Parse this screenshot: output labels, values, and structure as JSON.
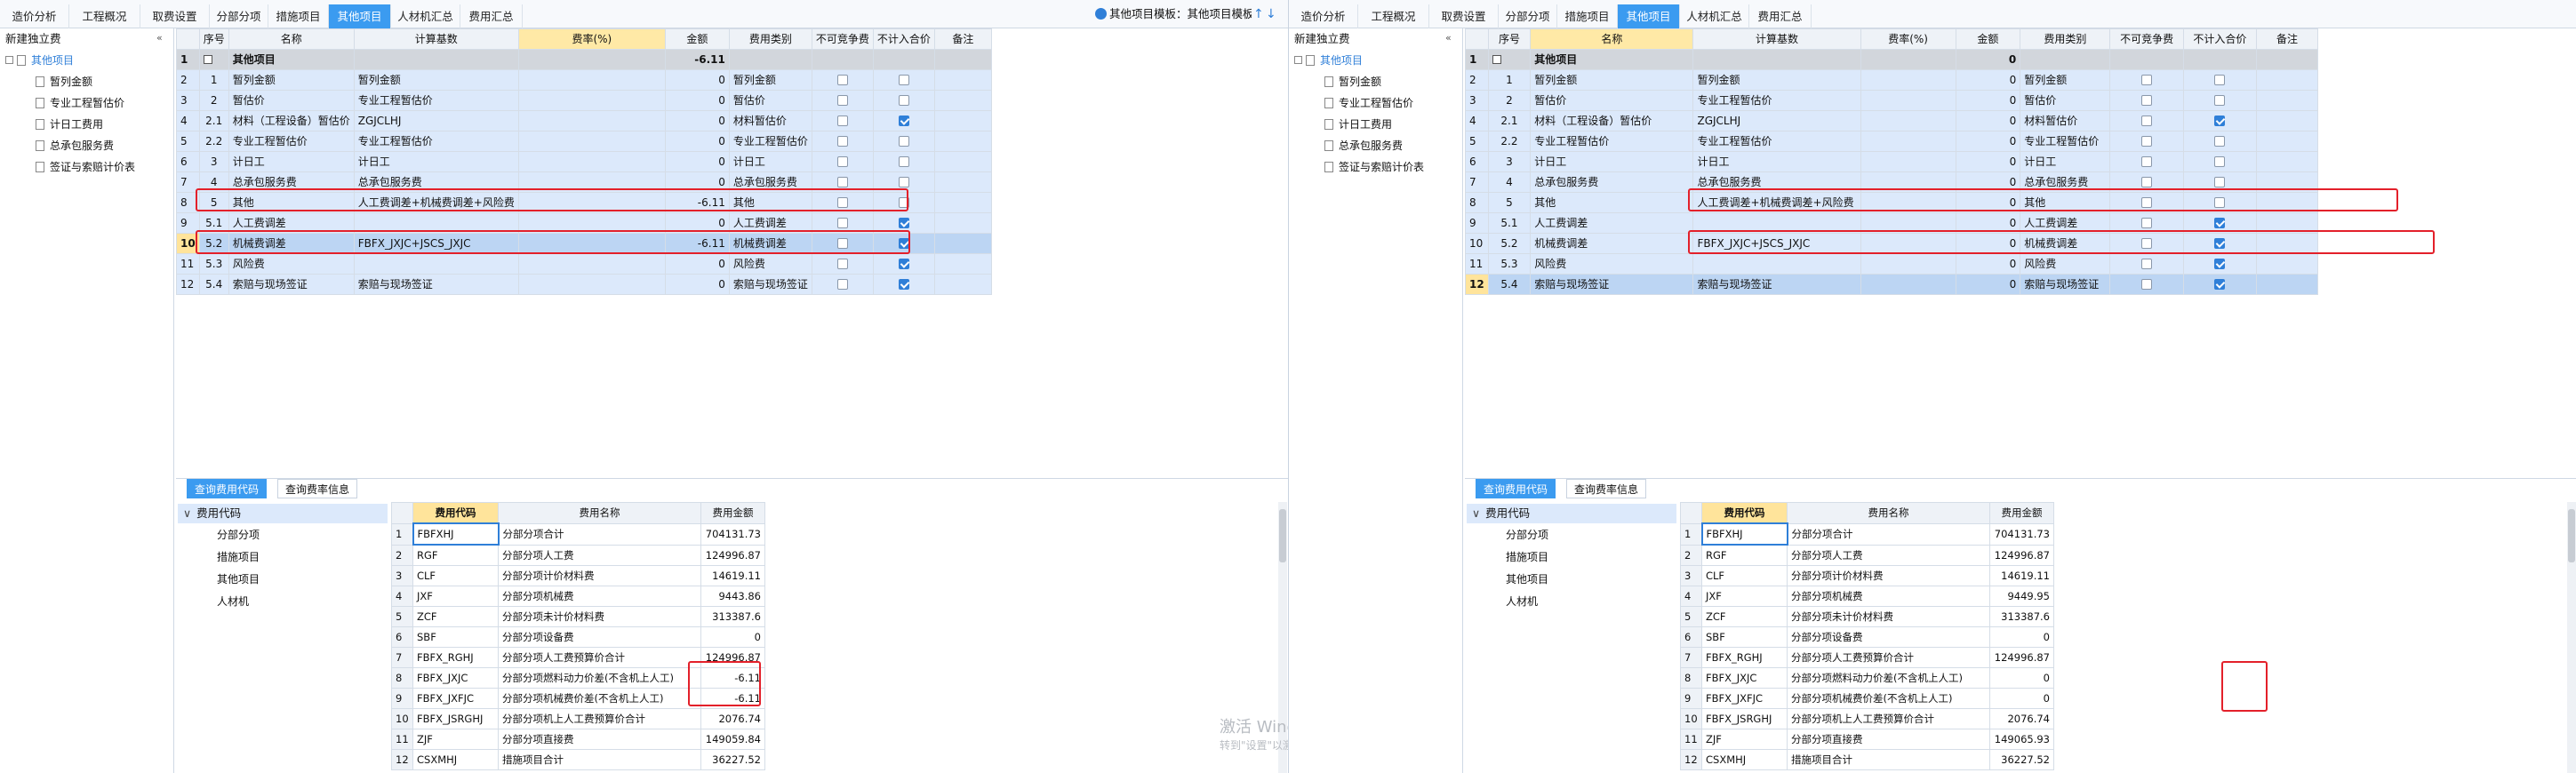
{
  "menu_tabs": [
    "造价分析",
    "工程概况",
    "取费设置",
    "分部分项",
    "措施项目",
    "其他项目",
    "人材机汇总",
    "费用汇总"
  ],
  "active_tab_index": 5,
  "template_label": "其他项目模板：其他项目模板",
  "left_title": "新建独立费",
  "tree": {
    "root": "其他项目",
    "children": [
      "暂列金额",
      "专业工程暂估价",
      "计日工费用",
      "总承包服务费",
      "签证与索赔计价表"
    ]
  },
  "grid_headers": [
    "序号",
    "名称",
    "计算基数",
    "费率(%)",
    "金额",
    "费用类别",
    "不可竞争费",
    "不计入合价",
    "备注"
  ],
  "left_grid": {
    "head_row": {
      "num": "1",
      "seq": "",
      "name": "其他项目",
      "base": "",
      "rate": "",
      "amount": "-6.11",
      "cat": ""
    },
    "rows": [
      {
        "num": "2",
        "seq": "1",
        "name": "暂列金额",
        "base": "暂列金额",
        "rate": "",
        "amount": "0",
        "cat": "暂列金额",
        "c1": false,
        "c2": false
      },
      {
        "num": "3",
        "seq": "2",
        "name": "暂估价",
        "base": "专业工程暂估价",
        "rate": "",
        "amount": "0",
        "cat": "暂估价",
        "c1": false,
        "c2": false
      },
      {
        "num": "4",
        "seq": "2.1",
        "name": "材料（工程设备）暂估价",
        "base": "ZGJCLHJ",
        "rate": "",
        "amount": "0",
        "cat": "材料暂估价",
        "c1": false,
        "c2": true
      },
      {
        "num": "5",
        "seq": "2.2",
        "name": "专业工程暂估价",
        "base": "专业工程暂估价",
        "rate": "",
        "amount": "0",
        "cat": "专业工程暂估价",
        "c1": false,
        "c2": false
      },
      {
        "num": "6",
        "seq": "3",
        "name": "计日工",
        "base": "计日工",
        "rate": "",
        "amount": "0",
        "cat": "计日工",
        "c1": false,
        "c2": false
      },
      {
        "num": "7",
        "seq": "4",
        "name": "总承包服务费",
        "base": "总承包服务费",
        "rate": "",
        "amount": "0",
        "cat": "总承包服务费",
        "c1": false,
        "c2": false
      },
      {
        "num": "8",
        "seq": "5",
        "name": "其他",
        "base": "人工费调差+机械费调差+风险费",
        "rate": "",
        "amount": "-6.11",
        "cat": "其他",
        "c1": false,
        "c2": false
      },
      {
        "num": "9",
        "seq": "5.1",
        "name": "人工费调差",
        "base": "",
        "rate": "",
        "amount": "0",
        "cat": "人工费调差",
        "c1": false,
        "c2": true
      },
      {
        "num": "10",
        "seq": "5.2",
        "name": "机械费调差",
        "base": "FBFX_JXJC+JSCS_JXJC",
        "rate": "",
        "amount": "-6.11",
        "cat": "机械费调差",
        "c1": false,
        "c2": true
      },
      {
        "num": "11",
        "seq": "5.3",
        "name": "风险费",
        "base": "",
        "rate": "",
        "amount": "0",
        "cat": "风险费",
        "c1": false,
        "c2": true
      },
      {
        "num": "12",
        "seq": "5.4",
        "name": "索赔与现场签证",
        "base": "索赔与现场签证",
        "rate": "",
        "amount": "0",
        "cat": "索赔与现场签证",
        "c1": false,
        "c2": true
      }
    ]
  },
  "right_grid": {
    "head_row": {
      "num": "1",
      "seq": "",
      "name": "其他项目",
      "base": "",
      "rate": "",
      "amount": "0",
      "cat": ""
    },
    "rows": [
      {
        "num": "2",
        "seq": "1",
        "name": "暂列金额",
        "base": "暂列金额",
        "rate": "",
        "amount": "0",
        "cat": "暂列金额",
        "c1": false,
        "c2": false
      },
      {
        "num": "3",
        "seq": "2",
        "name": "暂估价",
        "base": "专业工程暂估价",
        "rate": "",
        "amount": "0",
        "cat": "暂估价",
        "c1": false,
        "c2": false
      },
      {
        "num": "4",
        "seq": "2.1",
        "name": "材料（工程设备）暂估价",
        "base": "ZGJCLHJ",
        "rate": "",
        "amount": "0",
        "cat": "材料暂估价",
        "c1": false,
        "c2": true
      },
      {
        "num": "5",
        "seq": "2.2",
        "name": "专业工程暂估价",
        "base": "专业工程暂估价",
        "rate": "",
        "amount": "0",
        "cat": "专业工程暂估价",
        "c1": false,
        "c2": false
      },
      {
        "num": "6",
        "seq": "3",
        "name": "计日工",
        "base": "计日工",
        "rate": "",
        "amount": "0",
        "cat": "计日工",
        "c1": false,
        "c2": false
      },
      {
        "num": "7",
        "seq": "4",
        "name": "总承包服务费",
        "base": "总承包服务费",
        "rate": "",
        "amount": "0",
        "cat": "总承包服务费",
        "c1": false,
        "c2": false
      },
      {
        "num": "8",
        "seq": "5",
        "name": "其他",
        "base": "人工费调差+机械费调差+风险费",
        "rate": "",
        "amount": "0",
        "cat": "其他",
        "c1": false,
        "c2": false
      },
      {
        "num": "9",
        "seq": "5.1",
        "name": "人工费调差",
        "base": "",
        "rate": "",
        "amount": "0",
        "cat": "人工费调差",
        "c1": false,
        "c2": true
      },
      {
        "num": "10",
        "seq": "5.2",
        "name": "机械费调差",
        "base": "FBFX_JXJC+JSCS_JXJC",
        "rate": "",
        "amount": "0",
        "cat": "机械费调差",
        "c1": false,
        "c2": true
      },
      {
        "num": "11",
        "seq": "5.3",
        "name": "风险费",
        "base": "",
        "rate": "",
        "amount": "0",
        "cat": "风险费",
        "c1": false,
        "c2": true
      },
      {
        "num": "12",
        "seq": "5.4",
        "name": "索赔与现场签证",
        "base": "索赔与现场签证",
        "rate": "",
        "amount": "0",
        "cat": "索赔与现场签证",
        "c1": false,
        "c2": true
      }
    ]
  },
  "bottom_tabs": [
    "查询费用代码",
    "查询费率信息"
  ],
  "code_tree": {
    "root": "费用代码",
    "children": [
      "分部分项",
      "措施项目",
      "其他项目",
      "人材机"
    ]
  },
  "code_headers": [
    "费用代码",
    "费用名称",
    "费用金额"
  ],
  "left_codes": [
    {
      "num": "1",
      "code": "FBFXHJ",
      "name": "分部分项合计",
      "amt": "704131.73"
    },
    {
      "num": "2",
      "code": "RGF",
      "name": "分部分项人工费",
      "amt": "124996.87"
    },
    {
      "num": "3",
      "code": "CLF",
      "name": "分部分项计价材料费",
      "amt": "14619.11"
    },
    {
      "num": "4",
      "code": "JXF",
      "name": "分部分项机械费",
      "amt": "9443.86"
    },
    {
      "num": "5",
      "code": "ZCF",
      "name": "分部分项未计价材料费",
      "amt": "313387.6"
    },
    {
      "num": "6",
      "code": "SBF",
      "name": "分部分项设备费",
      "amt": "0"
    },
    {
      "num": "7",
      "code": "FBFX_RGHJ",
      "name": "分部分项人工费预算价合计",
      "amt": "124996.87"
    },
    {
      "num": "8",
      "code": "FBFX_JXJC",
      "name": "分部分项燃料动力价差(不含机上人工)",
      "amt": "-6.11"
    },
    {
      "num": "9",
      "code": "FBFX_JXFJC",
      "name": "分部分项机械费价差(不含机上人工)",
      "amt": "-6.11"
    },
    {
      "num": "10",
      "code": "FBFX_JSRGHJ",
      "name": "分部分项机上人工费预算价合计",
      "amt": "2076.74"
    },
    {
      "num": "11",
      "code": "ZJF",
      "name": "分部分项直接费",
      "amt": "149059.84"
    },
    {
      "num": "12",
      "code": "CSXMHJ",
      "name": "措施项目合计",
      "amt": "36227.52"
    }
  ],
  "right_codes": [
    {
      "num": "1",
      "code": "FBFXHJ",
      "name": "分部分项合计",
      "amt": "704131.73"
    },
    {
      "num": "2",
      "code": "RGF",
      "name": "分部分项人工费",
      "amt": "124996.87"
    },
    {
      "num": "3",
      "code": "CLF",
      "name": "分部分项计价材料费",
      "amt": "14619.11"
    },
    {
      "num": "4",
      "code": "JXF",
      "name": "分部分项机械费",
      "amt": "9449.95"
    },
    {
      "num": "5",
      "code": "ZCF",
      "name": "分部分项未计价材料费",
      "amt": "313387.6"
    },
    {
      "num": "6",
      "code": "SBF",
      "name": "分部分项设备费",
      "amt": "0"
    },
    {
      "num": "7",
      "code": "FBFX_RGHJ",
      "name": "分部分项人工费预算价合计",
      "amt": "124996.87"
    },
    {
      "num": "8",
      "code": "FBFX_JXJC",
      "name": "分部分项燃料动力价差(不含机上人工)",
      "amt": "0"
    },
    {
      "num": "9",
      "code": "FBFX_JXFJC",
      "name": "分部分项机械费价差(不含机上人工)",
      "amt": "0"
    },
    {
      "num": "10",
      "code": "FBFX_JSRGHJ",
      "name": "分部分项机上人工费预算价合计",
      "amt": "2076.74"
    },
    {
      "num": "11",
      "code": "ZJF",
      "name": "分部分项直接费",
      "amt": "149065.93"
    },
    {
      "num": "12",
      "code": "CSXMHJ",
      "name": "措施项目合计",
      "amt": "36227.52"
    }
  ],
  "watermark": {
    "line1": "激活 Windows",
    "line2": "转到\"设置\"以激活 Windows。"
  },
  "colors": {
    "accent": "#3b9bf0",
    "highlight": "#e3202a",
    "row_blue": "#dce9fb"
  }
}
